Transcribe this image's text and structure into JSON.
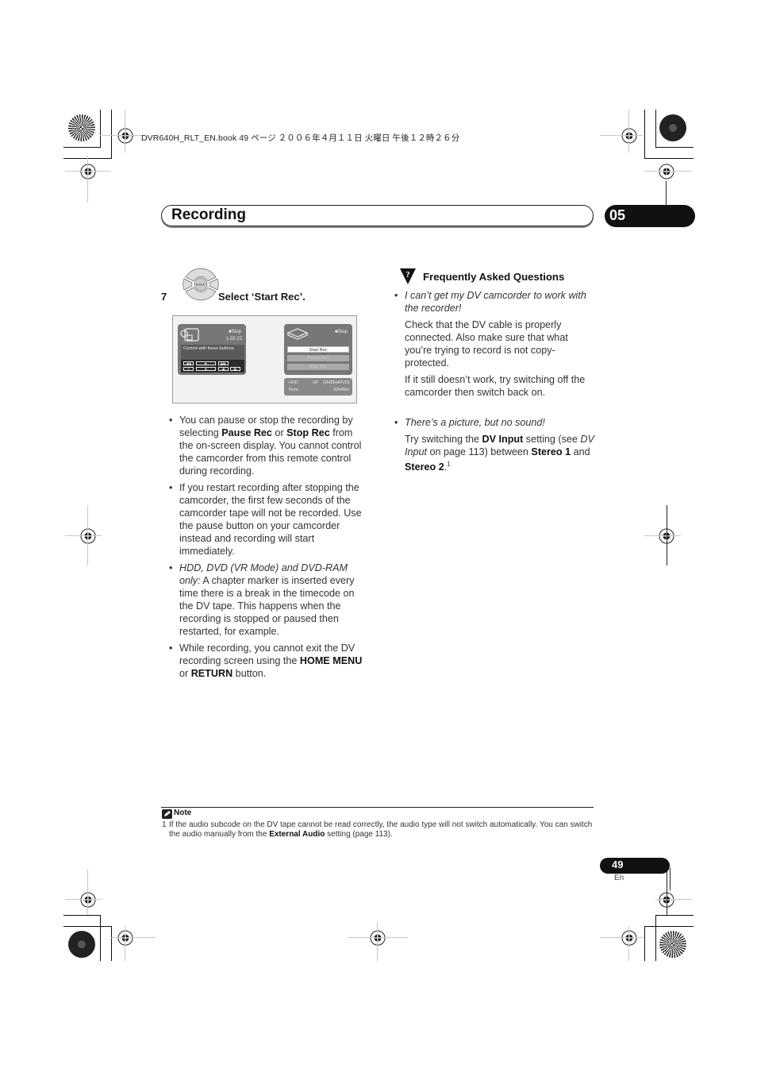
{
  "header": {
    "meta_line": "DVR640H_RLT_EN.book  49 ページ  ２００６年４月１１日  火曜日  午後１２時２６分"
  },
  "chapter": {
    "title": "Recording",
    "number": "05"
  },
  "step": {
    "number": "7",
    "icon": "enter-dpad-icon",
    "dpad_center_label": "ENTER",
    "instruction": "Select ‘Start Rec’."
  },
  "osd": {
    "camcorder": {
      "status": "■Stop",
      "timecode": "1.02.22",
      "control_label": "Control with these buttons",
      "buttons_row1": [
        "◀◀",
        "▶",
        "▶▶"
      ],
      "buttons_row2": [
        "II",
        "■",
        "◀I",
        "I▶"
      ]
    },
    "recorder": {
      "status": "■Stop",
      "menu": [
        {
          "label": "Start Rec",
          "state": "active"
        },
        {
          "label": "Pause Rec",
          "state": "disabled"
        },
        {
          "label": "Stop Rec",
          "state": "disabled"
        }
      ],
      "info_row1": {
        "left": "HDD",
        "mid": "SP",
        "right": "(2h00m/DVD)"
      },
      "info_row2": {
        "left": "Rem.",
        "right": "32h45m"
      }
    }
  },
  "left_bullets": [
    {
      "parts": [
        {
          "t": "You can pause or stop the recording by selecting ",
          "s": "n"
        },
        {
          "t": "Pause Rec",
          "s": "b"
        },
        {
          "t": " or ",
          "s": "n"
        },
        {
          "t": "Stop Rec",
          "s": "b"
        },
        {
          "t": " from the on-screen display. You cannot control the camcorder from this remote control during recording.",
          "s": "n"
        }
      ]
    },
    {
      "parts": [
        {
          "t": "If you restart recording after stopping the camcorder, the first few seconds of the camcorder tape will not be recorded. Use the pause button on your camcorder instead and recording will start immediately.",
          "s": "n"
        }
      ]
    },
    {
      "parts": [
        {
          "t": "HDD, DVD (VR Mode) and DVD-RAM only:",
          "s": "i"
        },
        {
          "t": " A chapter marker is inserted every time there is a break in the timecode on the DV tape. This happens when the recording is stopped or paused then restarted, for example.",
          "s": "n"
        }
      ]
    },
    {
      "parts": [
        {
          "t": "While recording, you cannot exit the DV recording screen using the ",
          "s": "n"
        },
        {
          "t": "HOME MENU",
          "s": "b"
        },
        {
          "t": " or ",
          "s": "n"
        },
        {
          "t": "RETURN",
          "s": "b"
        },
        {
          "t": " button.",
          "s": "n"
        }
      ]
    }
  ],
  "faq": {
    "title": "Frequently Asked Questions",
    "icon": "faq-question-icon",
    "items": [
      {
        "question": "I can’t get my DV camcorder to work with the recorder!",
        "answers": [
          [
            {
              "t": "Check that the DV cable is properly connected. Also make sure that what you’re trying to record is not copy-protected.",
              "s": "n"
            }
          ],
          [
            {
              "t": "If it still doesn’t work, try switching off the camcorder then switch back on.",
              "s": "n"
            }
          ]
        ]
      },
      {
        "question": "There’s a picture, but no sound!",
        "answers": [
          [
            {
              "t": "Try switching the ",
              "s": "n"
            },
            {
              "t": "DV Input",
              "s": "b"
            },
            {
              "t": " setting (see ",
              "s": "n"
            },
            {
              "t": "DV Input",
              "s": "i"
            },
            {
              "t": " on page 113) between ",
              "s": "n"
            },
            {
              "t": "Stereo 1",
              "s": "b"
            },
            {
              "t": " and ",
              "s": "n"
            },
            {
              "t": "Stereo 2",
              "s": "b"
            },
            {
              "t": ".",
              "s": "n"
            },
            {
              "t": "1",
              "s": "sup"
            }
          ]
        ]
      }
    ]
  },
  "note": {
    "label": "Note",
    "items": [
      {
        "number": "1",
        "parts": [
          {
            "t": "If the audio subcode on the DV tape cannot be read correctly, the audio type will not switch automatically. You can switch the audio manually from the ",
            "s": "n"
          },
          {
            "t": "External Audio",
            "s": "b"
          },
          {
            "t": " setting (page 113).",
            "s": "n"
          }
        ]
      }
    ]
  },
  "footer": {
    "page_number": "49",
    "language": "En"
  }
}
